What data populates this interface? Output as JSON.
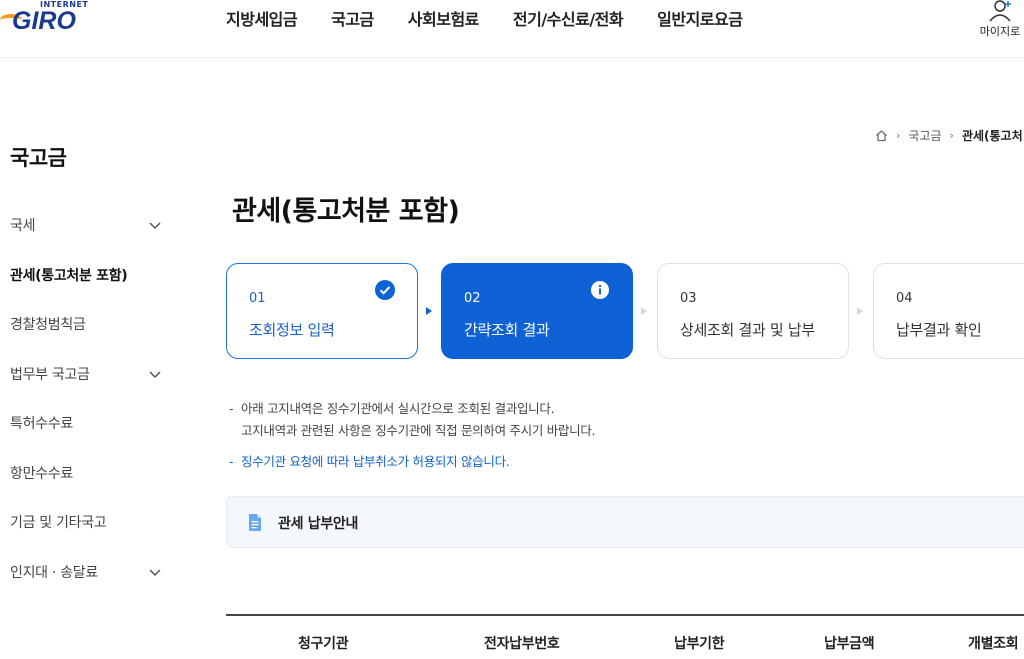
{
  "header": {
    "logo_small": "INTERNET",
    "logo_big": "GIRO",
    "nav": [
      "지방세입금",
      "국고금",
      "사회보험료",
      "전기/수신료/전화",
      "일반지로요금"
    ],
    "mypage_label": "마이지로"
  },
  "sidebar": {
    "title": "국고금",
    "items": [
      {
        "label": "국세",
        "expandable": true
      },
      {
        "label": "관세(통고처분 포함)",
        "active": true
      },
      {
        "label": "경찰청범칙금"
      },
      {
        "label": "법무부 국고금",
        "expandable": true
      },
      {
        "label": "특허수수료"
      },
      {
        "label": "항만수수료"
      },
      {
        "label": "기금 및 기타국고"
      },
      {
        "label": "인지대 · 송달료",
        "expandable": true
      }
    ]
  },
  "breadcrumb": {
    "level1": "국고금",
    "current": "관세(통고처"
  },
  "main": {
    "title": "관세(통고처분 포함)",
    "steps": [
      {
        "num": "01",
        "label": "조회정보 입력",
        "state": "done"
      },
      {
        "num": "02",
        "label": "간략조회 결과",
        "state": "current"
      },
      {
        "num": "03",
        "label": "상세조회 결과 및 납부",
        "state": "todo"
      },
      {
        "num": "04",
        "label": "납부결과 확인",
        "state": "todo"
      }
    ],
    "notice": {
      "line1": "아래 고지내역은 징수기관에서 실시간으로 조회된 결과입니다.",
      "line2": "고지내역과 관련된 사항은 징수기관에 직접 문의하여 주시기 바랍니다.",
      "line3": "징수기관 요청에 따라 납부취소가 허용되지 않습니다."
    },
    "guide_label": "관세 납부안내",
    "table_headers": [
      "청구기관",
      "전자납부번호",
      "납부기한",
      "납부금액",
      "개별조회"
    ]
  },
  "colors": {
    "primary": "#0f62d6",
    "brand_navy": "#1a3a8f",
    "brand_orange": "#f39b1b"
  }
}
